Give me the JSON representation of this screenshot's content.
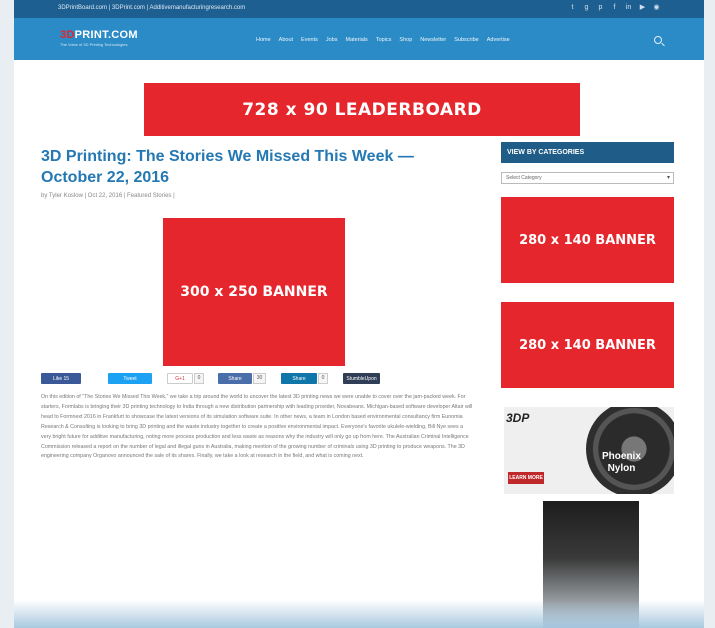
{
  "topbar": {
    "links": "3DPrintBoard.com | 3DPrint.com | Additivemanufacturingresearch.com",
    "social_icons": [
      "twitter-icon",
      "googleplus-icon",
      "pinterest-icon",
      "facebook-icon",
      "linkedin-icon",
      "youtube-icon",
      "rss-icon"
    ]
  },
  "header": {
    "logo_prefix": "3D",
    "logo_rest": "PRINT.COM",
    "tagline": "The Voice of 3D Printing Technologies",
    "menu": [
      "Home",
      "About",
      "Events",
      "Jobs",
      "Materials",
      "Topics",
      "Shop",
      "Newsletter",
      "Subscribe",
      "Advertise"
    ]
  },
  "ads": {
    "leaderboard": "728 x 90 LEADERBOARD",
    "big_banner": "300 x 250 BANNER",
    "side_banner_1": "280 x 140 BANNER",
    "side_banner_2": "280 x 140 BANNER"
  },
  "article": {
    "title": "3D Printing: The Stories We Missed This Week — October 22, 2016",
    "meta": "by Tyler Koslow | Oct 22, 2016 | Featured Stories |",
    "body": "On this edition of \"The Stories We Missed This Week,\" we take a trip around the world to uncover the latest 3D printing news we were unable to cover over the jam-packed week. For starters, Formlabs is bringing their 3D printing technology to India through a new distribution partnership with leading provider, Novabeans. Michigan-based software developer Altair will head to Formnext 2016 in Frankfurt to showcase the latest versions of its simulation software suite. In other news, a team in London based environmental consultancy firm Eunomia Research & Consulting is looking to bring 3D printing and the waste industry together to create a positive environmental impact. Everyone's favorite ukulele-wielding, Bill Nye sees a very bright future for additive manufacturing, noting more process production and less waste as reasons why the industry will only go up from here. The Australian Criminal Intelligence Commission released a report on the number of legal and illegal guns in Australia, making mention of the growing number of criminals using 3D printing to produce weapons. The 3D engineering company Organovo announced the sale of its shares. Finally, we take a look at research in the field, and what is coming next."
  },
  "share": {
    "like": "Like 15",
    "tweet": "Tweet",
    "gplus": "G+1",
    "gplus_count": "0",
    "share": "Share",
    "share_count": "30",
    "linkedin": "Share",
    "linkedin_count": "0",
    "stumble": "StumbleUpon"
  },
  "sidebar": {
    "categories_header": "VIEW BY CATEGORIES",
    "categories_select": "Select Category"
  },
  "promo": {
    "brand": "3DP",
    "button": "LEARN MORE",
    "product_line1": "Phoenix",
    "product_line2": "Nylon"
  },
  "colors": {
    "topbar": "#1e5f91",
    "navbar": "#2b8bc6",
    "ad_red": "#e5262c",
    "title_blue": "#2478b3",
    "sidebar_header": "#1f5c87"
  }
}
